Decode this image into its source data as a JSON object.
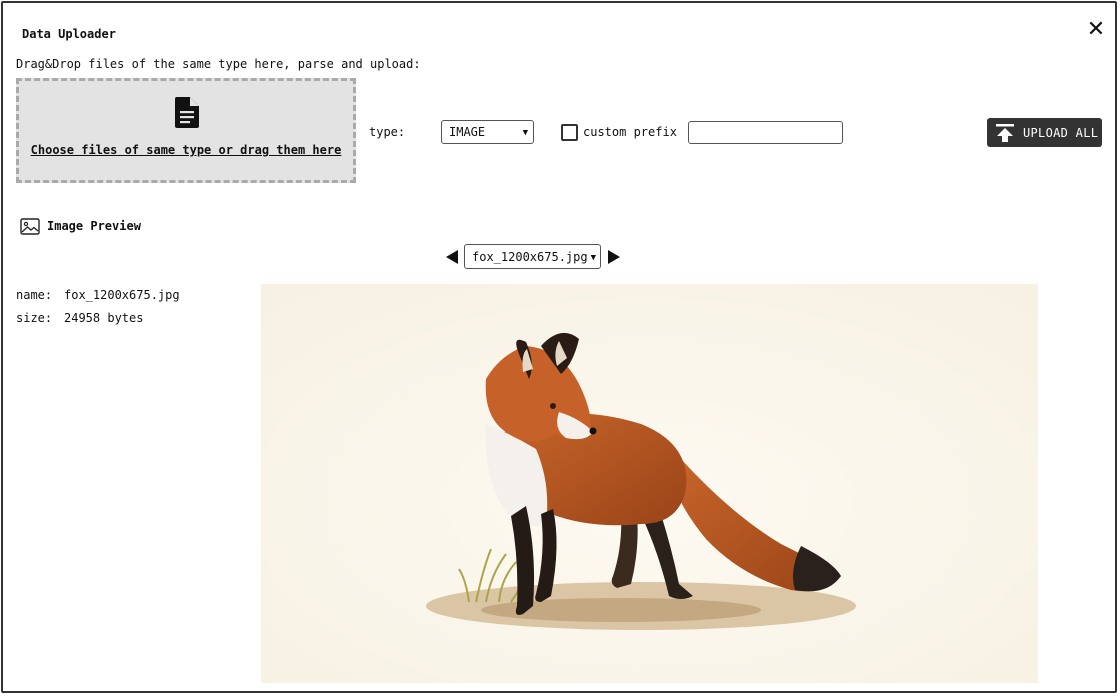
{
  "dialog": {
    "title": "Data Uploader",
    "close_glyph": "✕"
  },
  "uploader": {
    "instructions": "Drag&Drop files of the same type here, parse and upload:",
    "drop_label": "Choose files of same type or drag them here",
    "drop_icon": "document-icon",
    "type_label": "type:",
    "type_value": "IMAGE",
    "custom_prefix_label": "custom prefix",
    "custom_prefix_checked": false,
    "custom_prefix_value": "",
    "upload_label": "UPLOAD ALL",
    "upload_icon": "upload-icon",
    "button_color": "#333333"
  },
  "preview": {
    "title": "Image Preview",
    "icon": "image-icon",
    "selected_file": "fox_1200x675.jpg",
    "name_label": "name:",
    "name_value": "fox_1200x675.jpg",
    "size_label": "size:",
    "size_value": "24958 bytes"
  }
}
